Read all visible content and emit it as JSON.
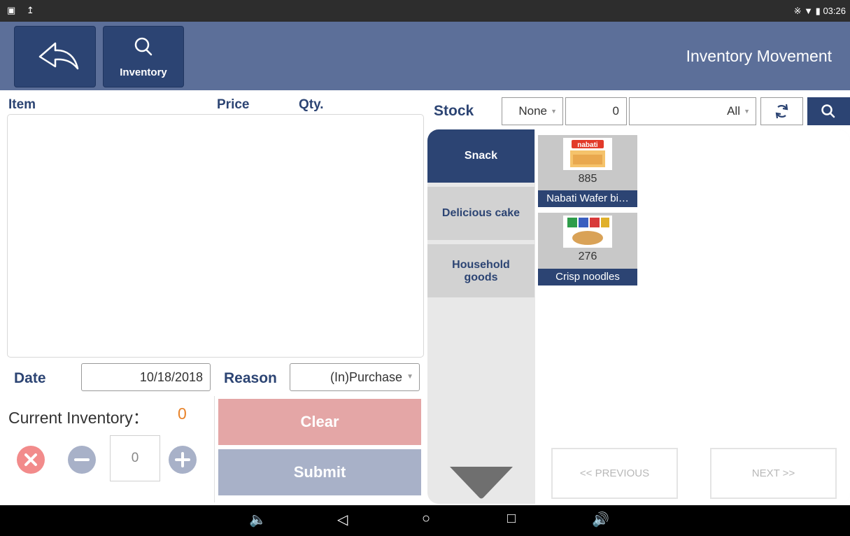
{
  "status_bar": {
    "time": "03:26"
  },
  "header": {
    "title": "Inventory Movement",
    "inventory_label": "Inventory"
  },
  "cart": {
    "col_item": "Item",
    "col_price": "Price",
    "col_qty": "Qty."
  },
  "form": {
    "date_label": "Date",
    "date_value": "10/18/2018",
    "reason_label": "Reason",
    "reason_value": "(In)Purchase",
    "current_inventory_label": "Current Inventory：",
    "current_inventory_value": "0",
    "qty_value": "0",
    "clear_label": "Clear",
    "submit_label": "Submit"
  },
  "stock_bar": {
    "label": "Stock",
    "filter_value": "None",
    "number_value": "0",
    "category_value": "All"
  },
  "categories": [
    {
      "label": "Snack",
      "active": true
    },
    {
      "label": "Delicious cake",
      "active": false
    },
    {
      "label": "Household goods",
      "active": false
    }
  ],
  "products": [
    {
      "name": "Nabati Wafer bi…",
      "stock": "885",
      "image_text": "nabati"
    },
    {
      "name": "Crisp noodles",
      "stock": "276"
    }
  ],
  "pager": {
    "previous": "<< PREVIOUS",
    "next": "NEXT >>"
  },
  "colors": {
    "primary": "#2c4473",
    "header": "#5c6f99",
    "clear": "#e4a6a6",
    "submit": "#a8b1c8",
    "accent_orange": "#e8832a",
    "remove_red": "#f28b8b"
  }
}
